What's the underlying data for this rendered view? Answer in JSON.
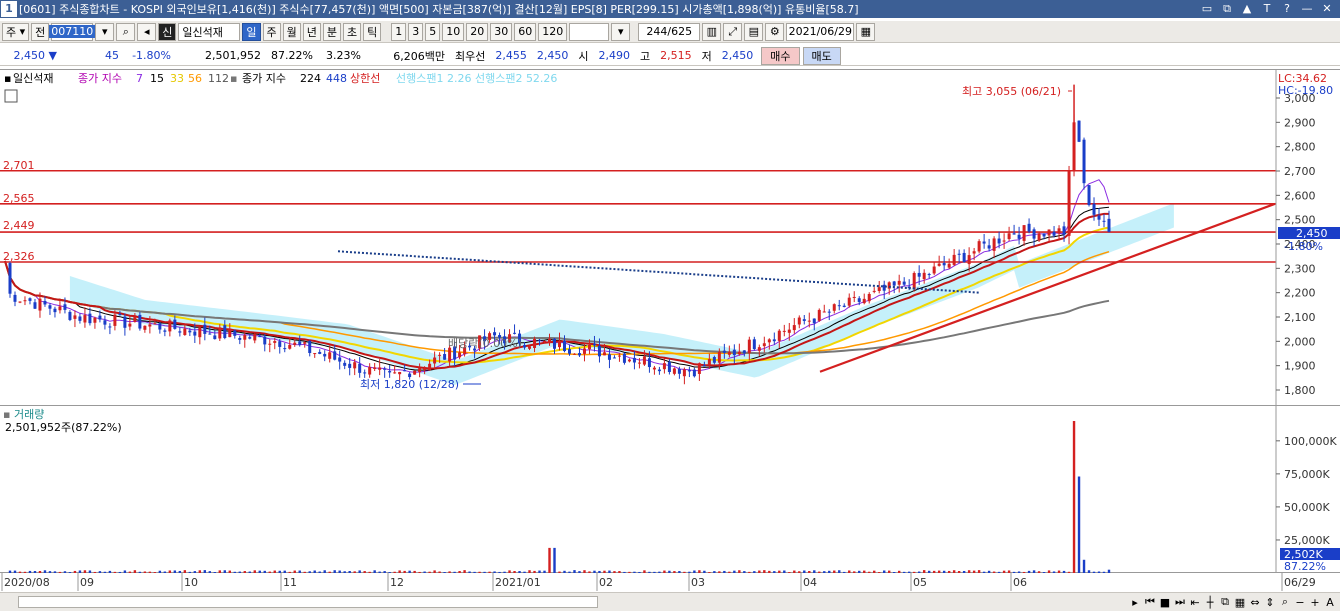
{
  "titlebar": {
    "number": "1",
    "title": "[0601] 주식종합차트 - KOSPI 외국인보유[1,416(천)] 주식수[77,457(천)] 액면[500] 자본금[387(억)] 결산[12월] EPS[8] PER[299.15] 시가총액[1,898(억)] 유통비율[58.7]",
    "icons": [
      "restore-icon",
      "copy-icon",
      "pin-icon",
      "text-icon",
      "help-icon",
      "minimize-icon",
      "close-icon"
    ]
  },
  "toolbar": {
    "market": "주",
    "jeon": "전",
    "code": "007110",
    "new_label": "신",
    "name": "일신석재",
    "periods": [
      "일",
      "주",
      "월",
      "년",
      "분",
      "초",
      "틱"
    ],
    "selected_period": "일",
    "intervals": [
      "1",
      "3",
      "5",
      "10",
      "20",
      "30",
      "60",
      "120"
    ],
    "count": "244",
    "total": "/625",
    "date": "2021/06/29"
  },
  "quote": {
    "price": "2,450",
    "arrow": "▼",
    "change": "45",
    "rate": "-1.80%",
    "volume": "2,501,952",
    "vol_rate": "87.22%",
    "turnover": "3.23%",
    "amount": "6,206백만",
    "bid_label": "최우선",
    "bid1": "2,455",
    "bid2": "2,450",
    "open_label": "시",
    "open": "2,490",
    "high_label": "고",
    "high": "2,515",
    "low_label": "저",
    "low": "2,450",
    "buy": "매수",
    "sell": "매도"
  },
  "chart_legend": {
    "name": "일신석재",
    "ma_label": "종가 지수",
    "ma_values": [
      "7",
      "15",
      "33",
      "56",
      "112"
    ],
    "ma2_label": "종가 지수",
    "ma2_values": [
      "224",
      "448"
    ],
    "limit_label": "상한선",
    "ichimoku": "선행스팬1 2.26  선행스팬2 52.26"
  },
  "chart_annotations": {
    "high": "최고 3,055 (06/21)",
    "low": "최저 1,820 (12/28)",
    "dividend": "배당락(0.00%)",
    "right_lc": "LC:34.62",
    "right_hc": "HC:-19.80",
    "current_tag": "2,450",
    "current_rate": "-1.80%",
    "hline_labels": [
      "2,701",
      "2,565",
      "2,449",
      "2,326"
    ],
    "vol_title": "거래량",
    "vol_value": "2,501,952주(87.22%)",
    "vol_tag": "2,502K",
    "vol_rate": "87.22%"
  },
  "chart_data": [
    {
      "type": "candlestick",
      "title": "일신석재",
      "y_ticks": [
        "3,000",
        "2,900",
        "2,800",
        "2,700",
        "2,600",
        "2,500",
        "2,400",
        "2,300",
        "2,200",
        "2,100",
        "2,000",
        "1,900",
        "1,800"
      ],
      "ylim": [
        1740,
        3090
      ],
      "horizontal_lines": [
        2701,
        2565,
        2449,
        2326
      ],
      "high": {
        "value": 3055,
        "date": "06/21"
      },
      "low": {
        "value": 1820,
        "date": "12/28"
      },
      "close": 2450,
      "x_labels": [
        "2020/08",
        "09",
        "10",
        "11",
        "12",
        "2021/01",
        "02",
        "03",
        "04",
        "05",
        "06",
        "06/29"
      ],
      "approx_close_by_month": [
        {
          "month": "2020/08",
          "close": 2200
        },
        {
          "month": "09",
          "close": 2100
        },
        {
          "month": "10",
          "close": 2050
        },
        {
          "month": "11",
          "close": 2000
        },
        {
          "month": "12",
          "close": 1850
        },
        {
          "month": "2021/01",
          "close": 2020
        },
        {
          "month": "02",
          "close": 1960
        },
        {
          "month": "03",
          "close": 1880
        },
        {
          "month": "04",
          "close": 2080
        },
        {
          "month": "05",
          "close": 2250
        },
        {
          "month": "06",
          "close": 2450
        }
      ]
    },
    {
      "type": "bar",
      "title": "거래량",
      "y_ticks": [
        "100,000K",
        "75,000K",
        "50,000K",
        "25,000K"
      ],
      "ylim": [
        0,
        115000
      ],
      "notable_bars": [
        {
          "date": "2021/01",
          "value": 19000
        },
        {
          "date": "06/21",
          "value": 115000
        },
        {
          "date": "06/22",
          "value": 73000
        },
        {
          "date": "06/23",
          "value": 10000
        },
        {
          "date": "06/29",
          "value": 2502
        }
      ]
    }
  ]
}
